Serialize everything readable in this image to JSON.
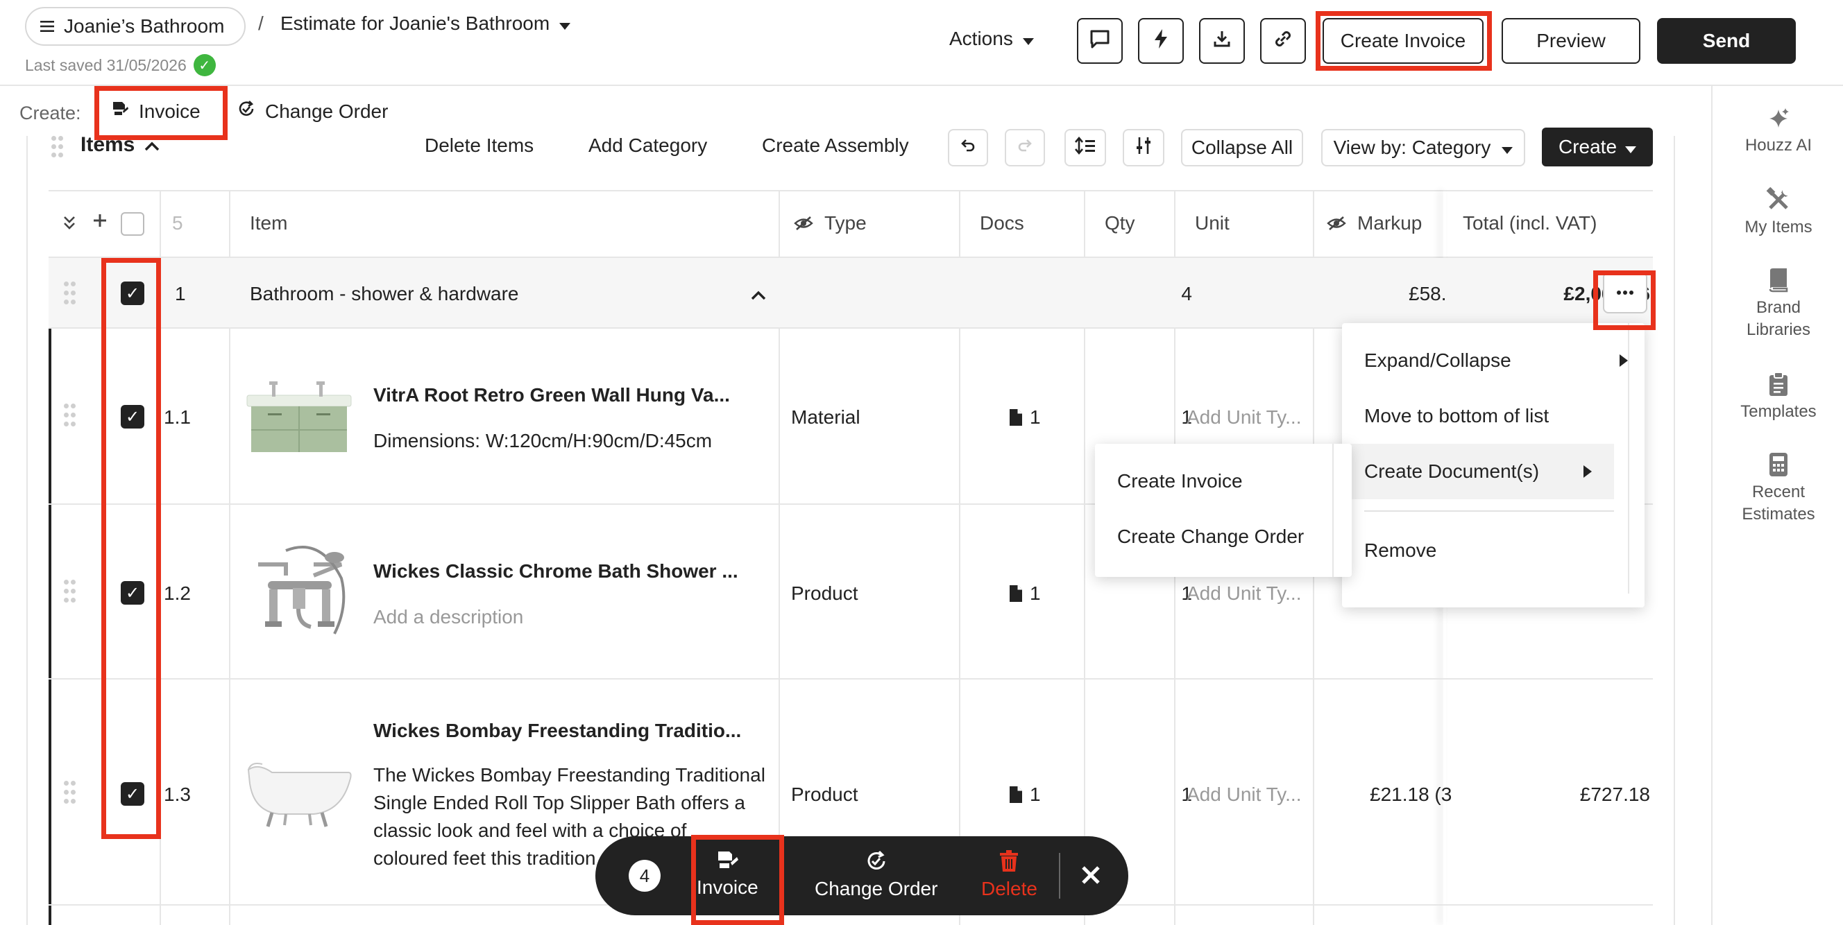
{
  "header": {
    "project_name": "Joanie’s Bathroom",
    "separator": "/",
    "document_title": "Estimate for Joanie's Bathroom",
    "last_saved": "Last saved 31/05/2026",
    "actions_label": "Actions",
    "create_invoice_label": "Create Invoice",
    "preview_label": "Preview",
    "send_label": "Send"
  },
  "create_bar": {
    "label": "Create:",
    "invoice_label": "Invoice",
    "change_order_label": "Change Order"
  },
  "toolbar": {
    "section_title": "Items",
    "delete_items": "Delete Items",
    "add_category": "Add Category",
    "create_assembly": "Create Assembly",
    "collapse_all": "Collapse All",
    "view_by": "View by: Category",
    "create": "Create"
  },
  "table": {
    "count": "5",
    "columns": {
      "item": "Item",
      "type": "Type",
      "docs": "Docs",
      "qty": "Qty",
      "unit": "Unit",
      "markup": "Markup",
      "total": "Total (incl. VAT)"
    },
    "category": {
      "number": "1",
      "name": "Bathroom - shower & hardware",
      "qty": "4",
      "markup": "£58.",
      "total": "£2,068.46"
    },
    "items": [
      {
        "number": "1.1",
        "title": "VitrA Root Retro Green Wall Hung Va...",
        "description": "Dimensions: W:120cm/H:90cm/D:45cm",
        "type": "Material",
        "docs": "1",
        "qty": "1",
        "unit": "Add Unit Ty..."
      },
      {
        "number": "1.2",
        "title": "Wickes Classic Chrome Bath Shower ...",
        "description": "Add a description",
        "type": "Product",
        "docs": "1",
        "qty": "1",
        "unit": "Add Unit Ty..."
      },
      {
        "number": "1.3",
        "title": "Wickes Bombay Freestanding Traditio...",
        "description_lines": [
          "The Wickes Bombay Freestanding Traditional",
          "Single Ended Roll Top Slipper Bath offers a",
          "classic look and feel with a choice of",
          "coloured feet this tradition"
        ],
        "type": "Product",
        "docs": "1",
        "qty": "1",
        "unit": "Add Unit Ty...",
        "markup": "£21.18 (3",
        "total": "£727.18"
      }
    ]
  },
  "context_menu": {
    "expand_collapse": "Expand/Collapse",
    "move_to_bottom": "Move to bottom of list",
    "create_documents": "Create Document(s)",
    "remove": "Remove"
  },
  "submenu": {
    "create_invoice": "Create Invoice",
    "create_change_order": "Create Change Order"
  },
  "sidebar": {
    "items": [
      {
        "label": "Houzz AI",
        "icon": "sparkle-icon"
      },
      {
        "label": "My Items",
        "icon": "tools-icon"
      },
      {
        "label": "Brand Libraries",
        "icon": "book-icon"
      },
      {
        "label": "Templates",
        "icon": "clipboard-icon"
      },
      {
        "label": "Recent Estimates",
        "icon": "calculator-icon"
      }
    ]
  },
  "bulk_bar": {
    "count": "4",
    "invoice": "Invoice",
    "change_order": "Change Order",
    "delete": "Delete"
  },
  "colors": {
    "highlight": "#e8321c",
    "dark": "#222222",
    "success": "#3fb63f",
    "danger": "#e8321c"
  }
}
